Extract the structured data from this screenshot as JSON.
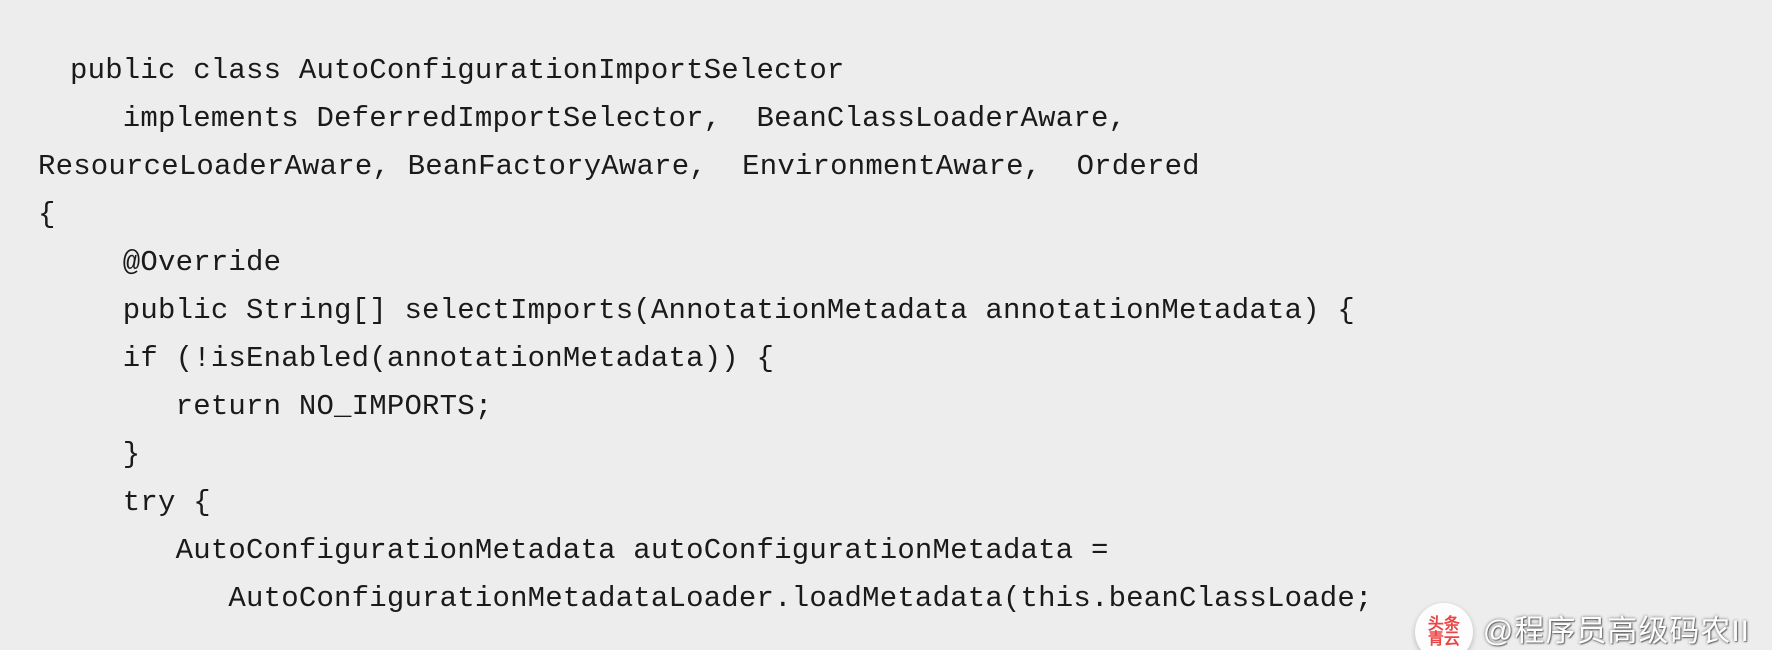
{
  "code": {
    "lines": [
      "public class AutoConfigurationImportSelector",
      "   implements DeferredImportSelector,  BeanClassLoaderAware,",
      "ResourceLoaderAware, BeanFactoryAware,  EnvironmentAware,  Ordered",
      "{",
      "   @Override",
      "   public String[] selectImports(AnnotationMetadata annotationMetadata) {",
      "   if (!isEnabled(annotationMetadata)) {",
      "      return NO_IMPORTS;",
      "   }",
      "   try {",
      "      AutoConfigurationMetadata autoConfigurationMetadata =",
      "         AutoConfigurationMetadataLoader.loadMetadata(this.beanClassLoade;"
    ]
  },
  "watermark": {
    "badge_top": "头条",
    "badge_bottom": "青云",
    "text": "@程序员高级码农II"
  }
}
